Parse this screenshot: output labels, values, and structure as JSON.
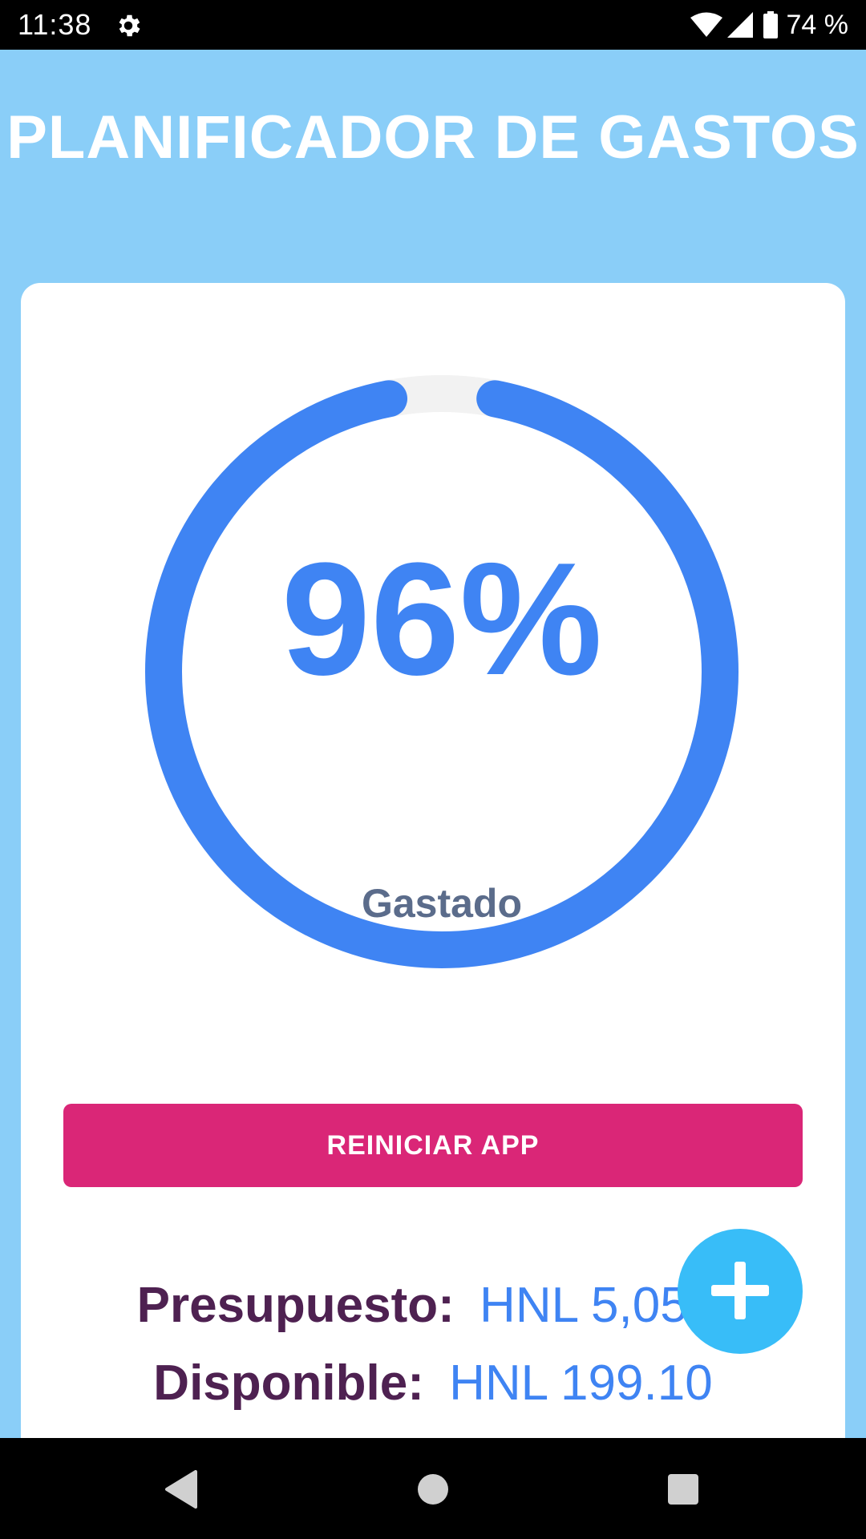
{
  "status_bar": {
    "time": "11:38",
    "battery": "74 %",
    "icons": [
      "settings-icon",
      "wifi-icon",
      "signal-icon",
      "battery-icon"
    ]
  },
  "header": {
    "title": "PLANIFICADOR DE GASTOS"
  },
  "progress": {
    "percent_text": "96%",
    "fraction": 0.96,
    "label": "Gastado",
    "color": "#3F84F3",
    "track_color": "#F2F2F2"
  },
  "actions": {
    "reset_label": "REINICIAR APP",
    "add_icon": "plus-icon"
  },
  "summary": {
    "budget_label": "Presupuesto:",
    "budget_value": "HNL 5,050.",
    "available_label": "Disponible:",
    "available_value": "HNL 199.10"
  },
  "nav_bar": {
    "buttons": [
      "back-icon",
      "home-icon",
      "recent-apps-icon"
    ]
  },
  "colors": {
    "background": "#8ACEF8",
    "accent": "#3F84F3",
    "reset_button": "#DA2677",
    "fab": "#38BDF8",
    "label_text": "#4E2151"
  }
}
